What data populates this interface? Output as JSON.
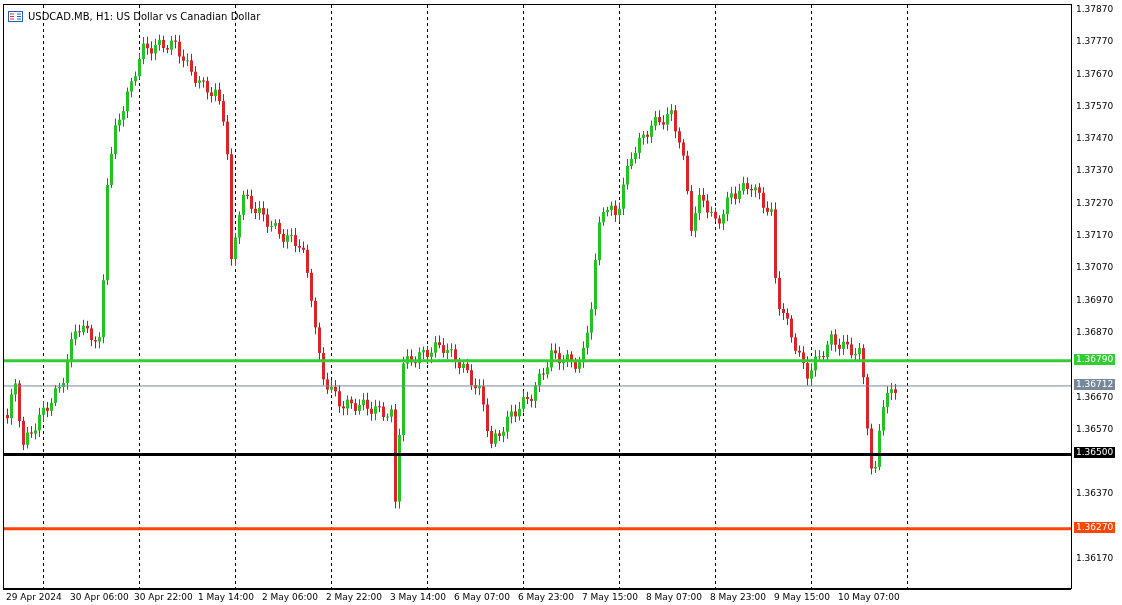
{
  "title": "USDCAD.MB, H1:  US Dollar vs Canadian Dollar",
  "price_axis": [
    "1.37870",
    "1.37770",
    "1.37670",
    "1.37570",
    "1.37470",
    "1.37370",
    "1.37270",
    "1.37170",
    "1.37070",
    "1.36970",
    "1.36870",
    "1.36670",
    "1.36570",
    "1.36370",
    "1.36170"
  ],
  "levels": [
    {
      "label": "1.36790",
      "color": "#33cc33",
      "kind": "level"
    },
    {
      "label": "1.36712",
      "color": "#778899",
      "kind": "price"
    },
    {
      "label": "1.36500",
      "color": "#000000",
      "kind": "level"
    },
    {
      "label": "1.36270",
      "color": "#ff4500",
      "kind": "level"
    }
  ],
  "time_axis": [
    "29 Apr 2024",
    "30 Apr 06:00",
    "30 Apr 22:00",
    "1 May 14:00",
    "2 May 06:00",
    "2 May 22:00",
    "3 May 14:00",
    "6 May 07:00",
    "6 May 23:00",
    "7 May 15:00",
    "8 May 07:00",
    "8 May 23:00",
    "9 May 15:00",
    "10 May 07:00"
  ]
}
